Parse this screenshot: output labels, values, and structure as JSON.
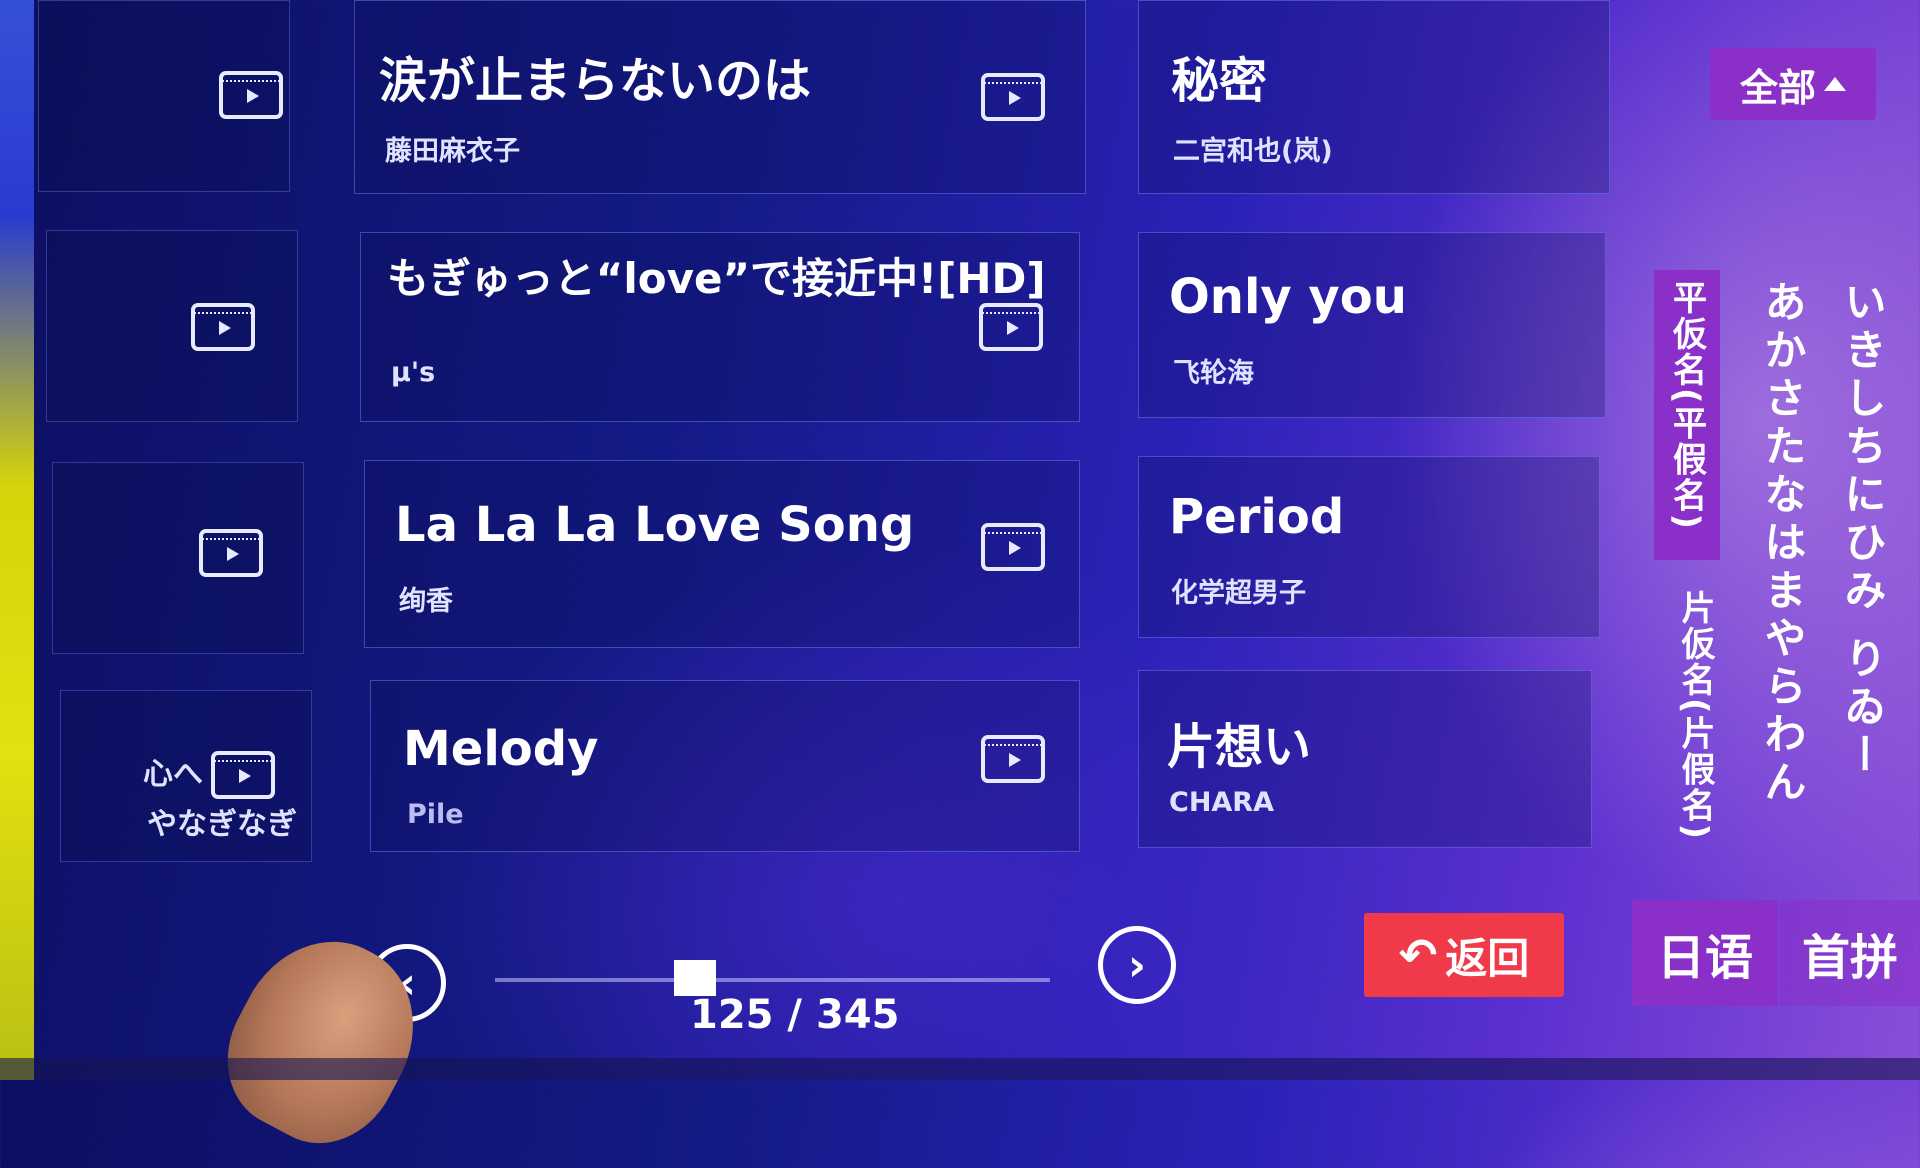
{
  "filter": {
    "label": "全部"
  },
  "songs": {
    "left": [
      {
        "title": "涙が止まらないのは",
        "artist": "藤田麻衣子"
      },
      {
        "title": "もぎゅっと“love”で接近中![HD]",
        "artist": "μ's"
      },
      {
        "title": "La La La Love Song",
        "artist": "绚香"
      },
      {
        "title": "Melody",
        "artist": "Pile"
      }
    ],
    "right": [
      {
        "title": "秘密",
        "artist": "二宫和也(岚)"
      },
      {
        "title": "Only you",
        "artist": "飞轮海"
      },
      {
        "title": "Period",
        "artist": "化学超男子"
      },
      {
        "title": "片想い",
        "artist": "CHARA"
      }
    ]
  },
  "leftcol": {
    "line1": "心へ",
    "line2": "やなぎなぎ"
  },
  "kana": {
    "hiragana_tab": "平仮名(平假名)",
    "katakana_tab": "片仮名(片假名)",
    "col1": "あかさたなはまやらわん",
    "col2": "いきしちにひみ りゐー"
  },
  "lang_tabs": {
    "japanese": "日语",
    "pinyin": "首拼"
  },
  "back": {
    "label": "返回"
  },
  "pagination": {
    "current": 125,
    "total": 345,
    "text": "125 / 345",
    "progress": 0.36
  },
  "nav": {
    "prev": "‹",
    "next": "›"
  }
}
